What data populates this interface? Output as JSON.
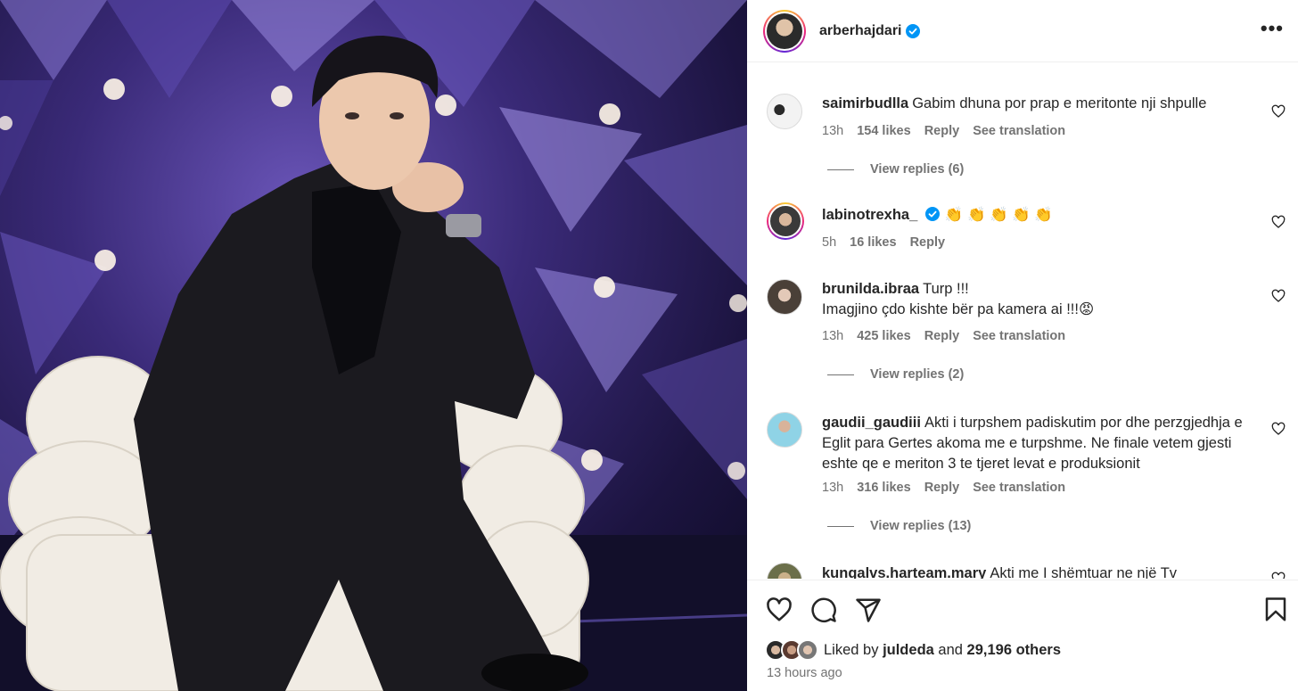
{
  "post": {
    "username": "arberhajdari",
    "more_label": "•••"
  },
  "comments": [
    {
      "username": "saimirbudlla",
      "text": "Gabim dhuna por prap e meritonte nji shpulle",
      "time": "13h",
      "likes": "154 likes",
      "reply": "Reply",
      "translate": "See translation",
      "view_replies": "View replies (6)"
    },
    {
      "username": "labinotrexha_",
      "text": "👏 👏 👏 👏 👏",
      "time": "5h",
      "likes": "16 likes",
      "reply": "Reply"
    },
    {
      "username": "brunilda.ibraa",
      "text_line1": "Turp !!!",
      "text_line2": "Imagjino çdo kishte bër pa kamera ai !!!😡",
      "time": "13h",
      "likes": "425 likes",
      "reply": "Reply",
      "translate": "See translation",
      "view_replies": "View replies (2)"
    },
    {
      "username": "gaudii_gaudiii",
      "text": "Akti i turpshem padiskutim por dhe perzgjedhja e Eglit para Gertes akoma me e turpshme. Ne finale vetem gjesti eshte qe e meriton 3 te tjeret levat e produksionit",
      "time": "13h",
      "likes": "316 likes",
      "reply": "Reply",
      "translate": "See translation",
      "view_replies": "View replies (13)"
    },
    {
      "username": "kungalvs.harteam.mary",
      "text": "Akti me I shëmtuar ne një Tv"
    }
  ],
  "likes": {
    "prefix": "Liked by",
    "user": "juldeda",
    "joiner": "and",
    "others": "29,196 others"
  },
  "time_ago": "13 hours ago",
  "colors": {
    "verified": "#0095f6",
    "secondary_text": "#737373",
    "text": "#262626"
  },
  "icons": [
    "heart-icon",
    "comment-icon",
    "share-icon",
    "bookmark-icon",
    "verified-icon",
    "more-icon"
  ]
}
